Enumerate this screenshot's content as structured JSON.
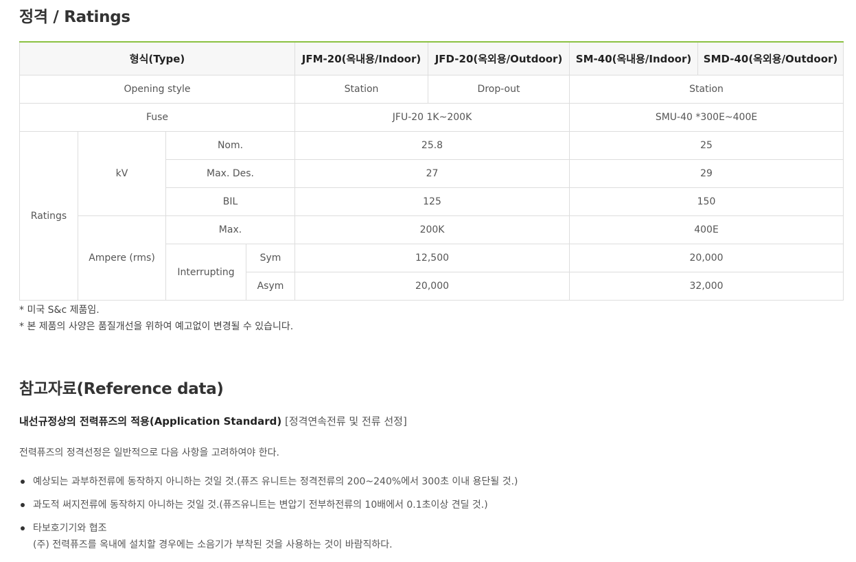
{
  "title": "정격 / Ratings",
  "table": {
    "header": {
      "type": "형식(Type)",
      "col1": "JFM-20(옥내용/Indoor)",
      "col2": "JFD-20(옥외용/Outdoor)",
      "col3": "SM-40(옥내용/Indoor)",
      "col4": "SMD-40(옥외용/Outdoor)"
    },
    "opening": {
      "label": "Opening style",
      "jfm": "Station",
      "jfd": "Drop-out",
      "sm": "Station"
    },
    "fuse": {
      "label": "Fuse",
      "jf": "JFU-20 1K~200K",
      "sm": "SMU-40 *300E~400E"
    },
    "ratings_label": "Ratings",
    "kv_label": "kV",
    "nom": {
      "label": "Nom.",
      "jf": "25.8",
      "sm": "25"
    },
    "maxdes": {
      "label": "Max. Des.",
      "jf": "27",
      "sm": "29"
    },
    "bil": {
      "label": "BIL",
      "jf": "125",
      "sm": "150"
    },
    "ampere_label": "Ampere (rms)",
    "max": {
      "label": "Max.",
      "jf": "200K",
      "sm": "400E"
    },
    "interrupting_label": "Interrupting",
    "sym": {
      "label": "Sym",
      "jf": "12,500",
      "sm": "20,000"
    },
    "asym": {
      "label": "Asym",
      "jf": "20,000",
      "sm": "32,000"
    }
  },
  "notes": [
    "* 미국 S&c 제품임.",
    "* 본 제품의 사양은 품질개선을 위하여 예고없이 변경될 수 있습니다."
  ],
  "reference": {
    "title": "참고자료(Reference data)",
    "subtitle_bold": "내선규정상의 전력퓨즈의 적용(Application Standard)",
    "subtitle_bracket": "[정격연속전류 및 전류 선정]",
    "intro": "전력퓨즈의 정격선정은 일반적으로 다음 사항을 고려하여야 한다.",
    "bullets": [
      "예상되는 과부하전류에 동작하지 아니하는 것일 것.(퓨즈 유니트는 정격전류의 200~240%에서 300초 이내 용단될 것.)",
      "과도적 써지전류에 동작하지 아니하는 것일 것.(퓨즈유니트는 변압기 전부하전류의 10배에서 0.1초이상 견딜 것.)",
      "타보호기기와 협조"
    ],
    "bullet3_sub": "(주) 전력퓨즈를 옥내에 설치할 경우에는 소음기가 부착된 것을 사용하는 것이 바람직하다."
  }
}
